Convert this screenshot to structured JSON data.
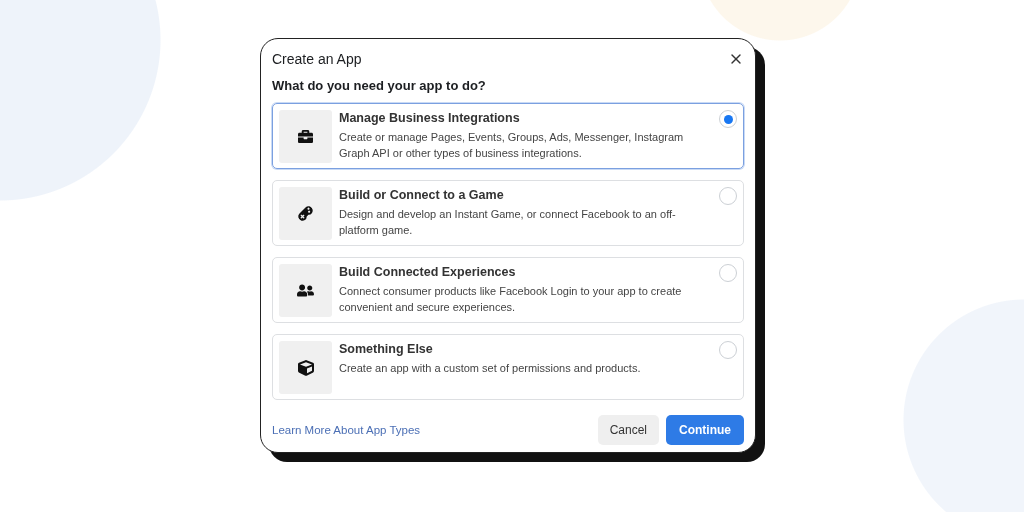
{
  "dialog": {
    "title": "Create an App",
    "question": "What do you need your app to do?",
    "options": [
      {
        "title": "Manage Business Integrations",
        "description": "Create or manage Pages, Events, Groups, Ads, Messenger, Instagram Graph API or other types of business integrations.",
        "selected": true
      },
      {
        "title": "Build or Connect to a Game",
        "description": "Design and develop an Instant Game, or connect Facebook to an off-platform game.",
        "selected": false
      },
      {
        "title": "Build Connected Experiences",
        "description": "Connect consumer products like Facebook Login to your app to create convenient and secure experiences.",
        "selected": false
      },
      {
        "title": "Something Else",
        "description": "Create an app with a custom set of permissions and products.",
        "selected": false
      }
    ],
    "link": "Learn More About App Types",
    "buttons": [
      {
        "label": "Cancel",
        "kind": "secondary"
      },
      {
        "label": "Continue",
        "kind": "primary"
      }
    ]
  }
}
